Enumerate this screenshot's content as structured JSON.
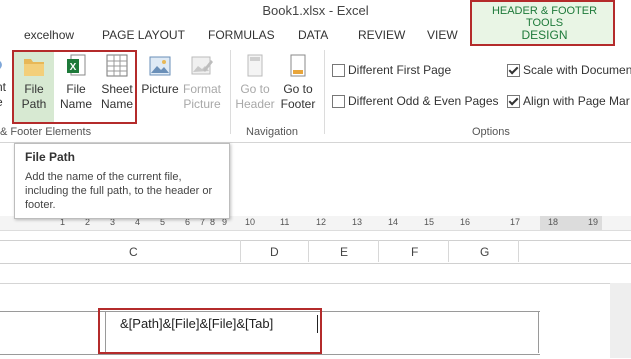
{
  "window": {
    "title": "Book1.xlsx - Excel"
  },
  "tabs": [
    "excelhow",
    "PAGE LAYOUT",
    "FORMULAS",
    "DATA",
    "REVIEW",
    "VIEW"
  ],
  "contextual": {
    "group_label": "HEADER & FOOTER TOOLS",
    "tab": "DESIGN",
    "color": "#1e7a3a"
  },
  "ribbon": {
    "partial_left": [
      "nt",
      "e"
    ],
    "elements": {
      "file_path": [
        "File",
        "Path"
      ],
      "file_name": [
        "File",
        "Name"
      ],
      "sheet_name": [
        "Sheet",
        "Name"
      ],
      "picture": [
        "Picture",
        ""
      ],
      "format_picture": [
        "Format",
        "Picture"
      ],
      "group_label": "& Footer Elements"
    },
    "navigation": {
      "go_to_header": [
        "Go to",
        "Header"
      ],
      "go_to_footer": [
        "Go to",
        "Footer"
      ],
      "group_label": "Navigation"
    },
    "options": {
      "items": [
        {
          "label": "Different First Page",
          "checked": false
        },
        {
          "label": "Different Odd & Even Pages",
          "checked": false
        },
        {
          "label": "Scale with Documen",
          "checked": true
        },
        {
          "label": "Align with Page Mar",
          "checked": true
        }
      ],
      "group_label": "Options"
    }
  },
  "tooltip": {
    "title": "File Path",
    "body": "Add the name of the current file, including the full path, to the header or footer."
  },
  "ruler": {
    "numbers": [
      "1",
      "2",
      "3",
      "4",
      "5",
      "6",
      "7",
      "8",
      "9",
      "10",
      "11",
      "12",
      "13",
      "14",
      "15",
      "16",
      "17",
      "18",
      "19"
    ]
  },
  "columns": [
    "C",
    "D",
    "E",
    "F",
    "G"
  ],
  "header": {
    "text": "&[Path]&[File]&[File]&[Tab]"
  },
  "accent": "#b42b2b"
}
